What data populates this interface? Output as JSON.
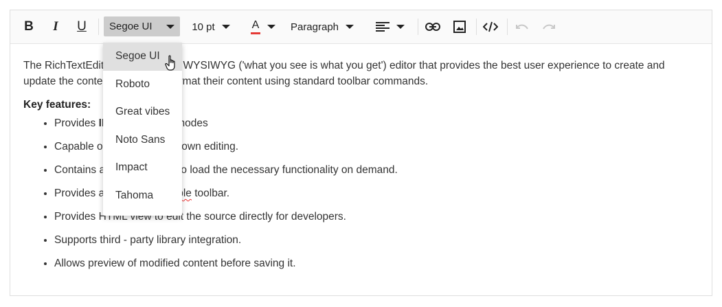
{
  "toolbar": {
    "bold_label": "B",
    "italic_label": "I",
    "underline_label": "U",
    "font_name": "Segoe UI",
    "font_size": "10 pt",
    "font_color_label": "A",
    "font_color": "#e53935",
    "format": "Paragraph",
    "icons": [
      "align-left-icon",
      "link-icon",
      "image-icon",
      "source-code-icon",
      "undo-icon",
      "redo-icon"
    ]
  },
  "font_dropdown": {
    "items": [
      "Segoe UI",
      "Roboto",
      "Great vibes",
      "Noto Sans",
      "Impact",
      "Tahoma"
    ],
    "selected": "Segoe UI"
  },
  "content": {
    "intro_a": "The RichTextEdit",
    "intro_b": " WYSIWYG ('what you see is what you get') editor that provides the best user experience to create and",
    "intro_c": "update the conte",
    "intro_d": "rmat their content using standard toolbar commands.",
    "key_features": "Key features:",
    "features": [
      {
        "a": "Provides ",
        "b": "II",
        "c": "modes"
      },
      {
        "a": "Capable o",
        "b": "",
        "c": "down editing."
      },
      {
        "a": "Contains a",
        "b": "",
        "c": "to load the necessary functionality on demand."
      },
      {
        "a": "Provides a",
        "b": "ble",
        "c": " toolbar."
      },
      {
        "a": "Provides HTML view to edit the source directly for developers.",
        "b": "",
        "c": ""
      },
      {
        "a": "Supports third - party library integration.",
        "b": "",
        "c": ""
      },
      {
        "a": "Allows preview of modified content before saving it.",
        "b": "",
        "c": ""
      }
    ]
  },
  "colors": {
    "toolbar_bg": "#fafafa",
    "font_button_bg": "#cccccc",
    "dropdown_active_bg": "#e0e0e0",
    "disabled_icon": "#c8c8c8"
  }
}
